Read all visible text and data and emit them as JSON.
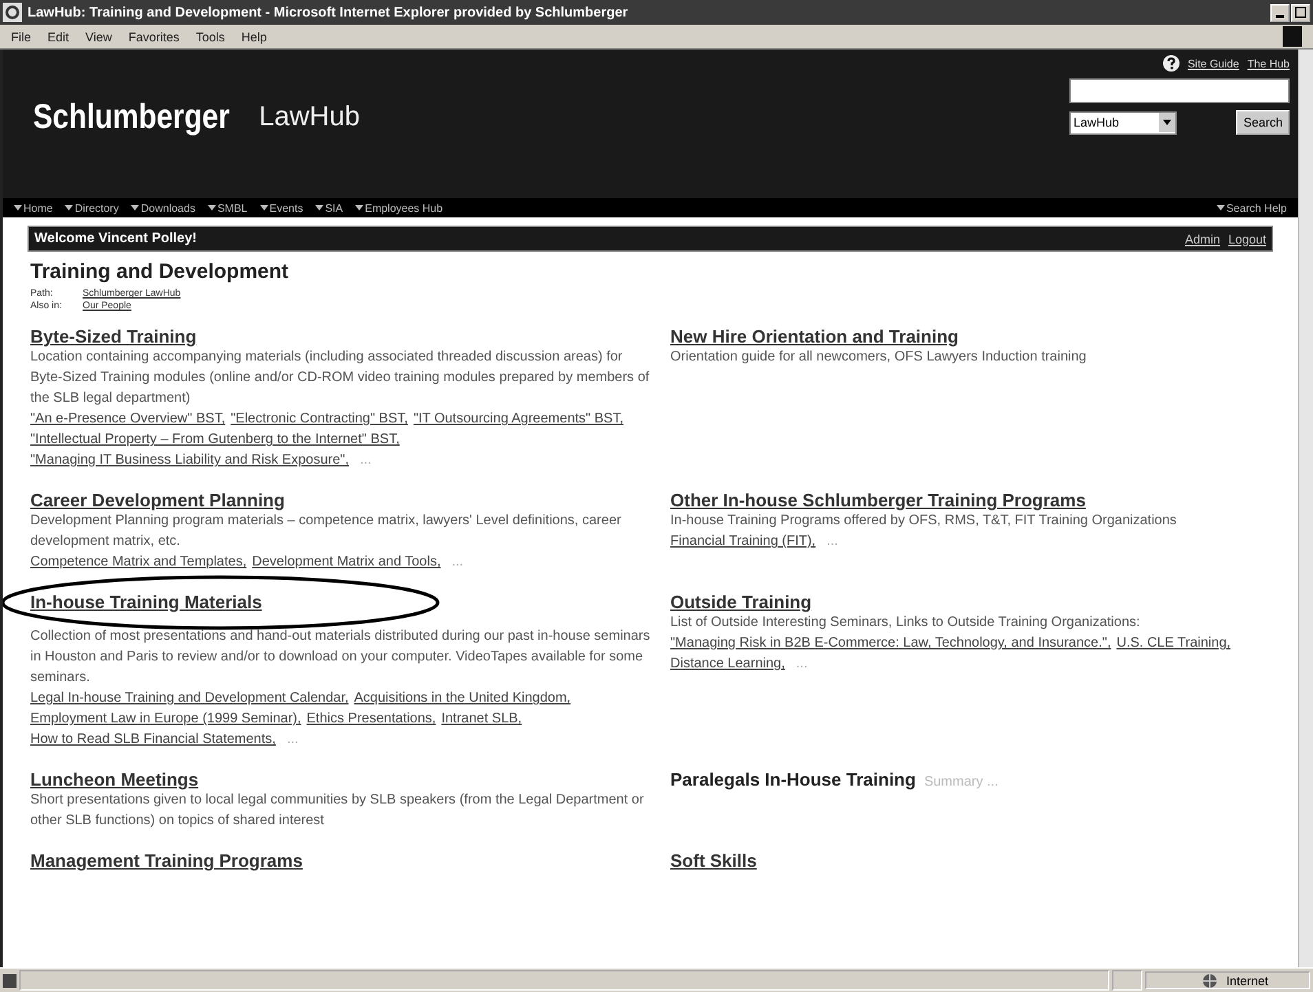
{
  "window": {
    "title": "LawHub: Training and Development - Microsoft Internet Explorer provided by Schlumberger"
  },
  "menu": [
    "File",
    "Edit",
    "View",
    "Favorites",
    "Tools",
    "Help"
  ],
  "header": {
    "logo": "Schlumberger",
    "product": "LawHub",
    "top_links": [
      "Site Guide",
      "The Hub"
    ],
    "search_scope": "LawHub",
    "search_button": "Search"
  },
  "nav": {
    "items": [
      "Home",
      "Directory",
      "Downloads",
      "SMBL",
      "Events",
      "SIA",
      "Employees Hub"
    ],
    "right": "Search Help"
  },
  "welcome": {
    "text": "Welcome Vincent Polley!",
    "links": [
      "Admin",
      "Logout"
    ]
  },
  "page": {
    "title": "Training and Development",
    "path_label": "Path:",
    "path": "Schlumberger LawHub",
    "also_label": "Also in:",
    "also": "Our People"
  },
  "sections": [
    {
      "title": "Byte-Sized Training",
      "kind": "link",
      "description": "Location containing accompanying materials (including associated threaded discussion areas) for Byte-Sized Training modules (online and/or CD-ROM video training modules prepared by members of the SLB legal department)",
      "links": [
        "\"An e-Presence Overview\" BST,",
        "\"Electronic Contracting\" BST,",
        "\"IT Outsourcing Agreements\" BST,",
        "\"Intellectual Property – From Gutenberg to the Internet\" BST,",
        "\"Managing IT Business Liability and Risk Exposure\","
      ],
      "more": "..."
    },
    {
      "title": "New Hire Orientation and Training",
      "kind": "link",
      "description": "Orientation guide for all newcomers, OFS Lawyers Induction training"
    },
    {
      "title": "Career Development Planning",
      "kind": "link",
      "description": "Development Planning program materials – competence matrix, lawyers' Level definitions, career development matrix, etc.",
      "links": [
        "Competence Matrix and Templates,",
        "Development Matrix and Tools,"
      ],
      "more": "..."
    },
    {
      "title": "Other In-house Schlumberger Training Programs",
      "kind": "link",
      "description": "In-house Training Programs offered by OFS, RMS, T&T, FIT Training Organizations",
      "links": [
        "Financial Training (FIT),"
      ],
      "more": "..."
    },
    {
      "title": "In-house Training Materials",
      "kind": "link",
      "circled": true,
      "description": "Collection of most presentations and hand-out materials distributed during our past in-house seminars in Houston and Paris to review and/or to download on your computer. VideoTapes available for some seminars.",
      "links": [
        "Legal In-house Training and Development Calendar,",
        "Acquisitions in the United Kingdom,",
        "Employment Law in Europe (1999 Seminar),",
        "Ethics Presentations,",
        "Intranet SLB,",
        "How to Read SLB Financial Statements,"
      ],
      "more": "..."
    },
    {
      "title": "Outside Training",
      "kind": "link",
      "description": "List of Outside Interesting Seminars, Links to Outside Training Organizations:",
      "links": [
        "\"Managing Risk in B2B E-Commerce: Law, Technology, and Insurance.\",",
        "U.S. CLE Training,",
        "Distance Learning,"
      ],
      "more": "..."
    },
    {
      "title": "Luncheon Meetings",
      "kind": "link",
      "description": "Short presentations given to local legal communities by SLB speakers (from the Legal Department or other SLB functions) on topics of shared interest"
    },
    {
      "title": "Paralegals In-House Training",
      "kind": "plain",
      "summary": "Summary ..."
    },
    {
      "title": "Management Training Programs",
      "kind": "link"
    },
    {
      "title": "Soft Skills",
      "kind": "link"
    }
  ],
  "status_bar": {
    "zone": "Internet"
  }
}
